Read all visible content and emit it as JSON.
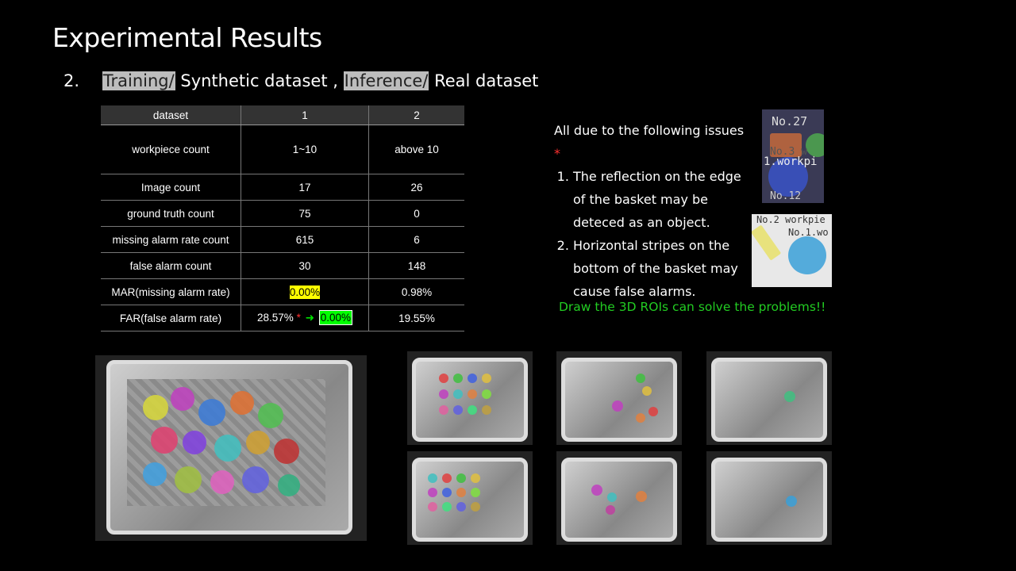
{
  "title": "Experimental Results",
  "subtitle": {
    "number": "2.",
    "training": "Training/",
    "synthetic": "Synthetic dataset ,",
    "inference": "Inference/",
    "real": "Real dataset"
  },
  "table": {
    "headers": [
      "dataset",
      "1",
      "2"
    ],
    "rows": [
      {
        "label": "workpiece count",
        "v1": "1~10",
        "v2": "above 10"
      },
      {
        "label": "Image count",
        "v1": "17",
        "v2": "26"
      },
      {
        "label": "ground truth count",
        "v1": "75",
        "v2": "0"
      },
      {
        "label": "missing alarm rate count",
        "v1": "615",
        "v2": "6"
      },
      {
        "label": "false alarm count",
        "v1": "30",
        "v2": "148"
      }
    ],
    "mar": {
      "label": "MAR(missing alarm rate)",
      "v1": "0.00%",
      "v2": "0.98%"
    },
    "far": {
      "label": "FAR(false alarm rate)",
      "v1_before": "28.57%",
      "star": "*",
      "arrow": "➜",
      "v1_after": "0.00%",
      "v2": "19.55%"
    }
  },
  "issues": {
    "heading": "All due to the following issues",
    "star": "*",
    "items": [
      "The reflection on the edge of the basket may be deteced as an object.",
      "Horizontal stripes on the bottom of the basket may cause false alarms."
    ]
  },
  "thumb1": {
    "labels": [
      "No.27",
      "No.3 w",
      "1.workpi",
      "No.12"
    ]
  },
  "thumb2": {
    "labels": [
      "No.2 workpie",
      "No.1.wo"
    ]
  },
  "solution": "Draw the 3D ROIs can solve the problems!!",
  "colors": {
    "highlight_yellow": "#ffff00",
    "highlight_green": "#00ff00",
    "solution_green": "#22cc22",
    "star_red": "#ff3030"
  }
}
